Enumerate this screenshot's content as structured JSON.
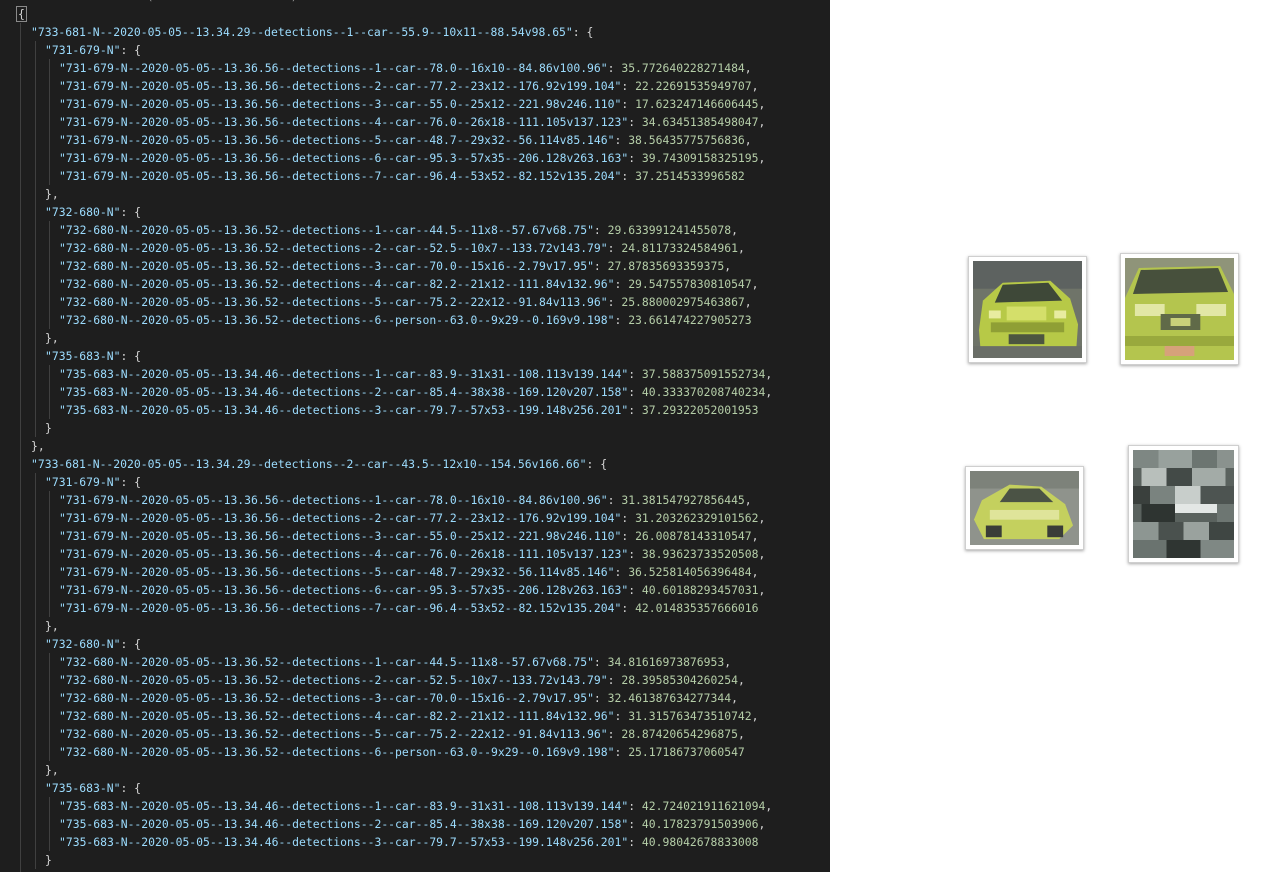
{
  "editor": {
    "top_peek": "                 (\"                   )",
    "open_brace": "{",
    "groups": [
      {
        "key": "733-681-N--2020-05-05--13.34.29--detections--1--car--55.9--10x11--88.54v98.65",
        "cameras": [
          {
            "key": "731-679-N",
            "entries": [
              {
                "k": "731-679-N--2020-05-05--13.36.56--detections--1--car--78.0--16x10--84.86v100.96",
                "v": "35.772640228271484"
              },
              {
                "k": "731-679-N--2020-05-05--13.36.56--detections--2--car--77.2--23x12--176.92v199.104",
                "v": "22.22691535949707"
              },
              {
                "k": "731-679-N--2020-05-05--13.36.56--detections--3--car--55.0--25x12--221.98v246.110",
                "v": "17.623247146606445"
              },
              {
                "k": "731-679-N--2020-05-05--13.36.56--detections--4--car--76.0--26x18--111.105v137.123",
                "v": "34.63451385498047"
              },
              {
                "k": "731-679-N--2020-05-05--13.36.56--detections--5--car--48.7--29x32--56.114v85.146",
                "v": "38.56435775756836"
              },
              {
                "k": "731-679-N--2020-05-05--13.36.56--detections--6--car--95.3--57x35--206.128v263.163",
                "v": "39.74309158325195"
              },
              {
                "k": "731-679-N--2020-05-05--13.36.56--detections--7--car--96.4--53x52--82.152v135.204",
                "v": "37.2514533996582"
              }
            ]
          },
          {
            "key": "732-680-N",
            "entries": [
              {
                "k": "732-680-N--2020-05-05--13.36.52--detections--1--car--44.5--11x8--57.67v68.75",
                "v": "29.633991241455078"
              },
              {
                "k": "732-680-N--2020-05-05--13.36.52--detections--2--car--52.5--10x7--133.72v143.79",
                "v": "24.81173324584961"
              },
              {
                "k": "732-680-N--2020-05-05--13.36.52--detections--3--car--70.0--15x16--2.79v17.95",
                "v": "27.87835693359375"
              },
              {
                "k": "732-680-N--2020-05-05--13.36.52--detections--4--car--82.2--21x12--111.84v132.96",
                "v": "29.547557830810547"
              },
              {
                "k": "732-680-N--2020-05-05--13.36.52--detections--5--car--75.2--22x12--91.84v113.96",
                "v": "25.880002975463867"
              },
              {
                "k": "732-680-N--2020-05-05--13.36.52--detections--6--person--63.0--9x29--0.169v9.198",
                "v": "23.661474227905273"
              }
            ]
          },
          {
            "key": "735-683-N",
            "entries": [
              {
                "k": "735-683-N--2020-05-05--13.34.46--detections--1--car--83.9--31x31--108.113v139.144",
                "v": "37.588375091552734"
              },
              {
                "k": "735-683-N--2020-05-05--13.34.46--detections--2--car--85.4--38x38--169.120v207.158",
                "v": "40.333370208740234"
              },
              {
                "k": "735-683-N--2020-05-05--13.34.46--detections--3--car--79.7--57x53--199.148v256.201",
                "v": "37.29322052001953"
              }
            ]
          }
        ]
      },
      {
        "key": "733-681-N--2020-05-05--13.34.29--detections--2--car--43.5--12x10--154.56v166.66",
        "cameras": [
          {
            "key": "731-679-N",
            "entries": [
              {
                "k": "731-679-N--2020-05-05--13.36.56--detections--1--car--78.0--16x10--84.86v100.96",
                "v": "31.381547927856445"
              },
              {
                "k": "731-679-N--2020-05-05--13.36.56--detections--2--car--77.2--23x12--176.92v199.104",
                "v": "31.203262329101562"
              },
              {
                "k": "731-679-N--2020-05-05--13.36.56--detections--3--car--55.0--25x12--221.98v246.110",
                "v": "26.00878143310547"
              },
              {
                "k": "731-679-N--2020-05-05--13.36.56--detections--4--car--76.0--26x18--111.105v137.123",
                "v": "38.93623733520508"
              },
              {
                "k": "731-679-N--2020-05-05--13.36.56--detections--5--car--48.7--29x32--56.114v85.146",
                "v": "36.525814056396484"
              },
              {
                "k": "731-679-N--2020-05-05--13.36.56--detections--6--car--95.3--57x35--206.128v263.163",
                "v": "40.60188293457031"
              },
              {
                "k": "731-679-N--2020-05-05--13.36.56--detections--7--car--96.4--53x52--82.152v135.204",
                "v": "42.014835357666016"
              }
            ]
          },
          {
            "key": "732-680-N",
            "entries": [
              {
                "k": "732-680-N--2020-05-05--13.36.52--detections--1--car--44.5--11x8--57.67v68.75",
                "v": "34.81616973876953"
              },
              {
                "k": "732-680-N--2020-05-05--13.36.52--detections--2--car--52.5--10x7--133.72v143.79",
                "v": "28.39585304260254"
              },
              {
                "k": "732-680-N--2020-05-05--13.36.52--detections--3--car--70.0--15x16--2.79v17.95",
                "v": "32.461387634277344"
              },
              {
                "k": "732-680-N--2020-05-05--13.36.52--detections--4--car--82.2--21x12--111.84v132.96",
                "v": "31.315763473510742"
              },
              {
                "k": "732-680-N--2020-05-05--13.36.52--detections--5--car--75.2--22x12--91.84v113.96",
                "v": "28.87420654296875"
              },
              {
                "k": "732-680-N--2020-05-05--13.36.52--detections--6--person--63.0--9x29--0.169v9.198",
                "v": "25.17186737060547"
              }
            ]
          },
          {
            "key": "735-683-N",
            "entries": [
              {
                "k": "735-683-N--2020-05-05--13.34.46--detections--1--car--83.9--31x31--108.113v139.144",
                "v": "42.724021911621094"
              },
              {
                "k": "735-683-N--2020-05-05--13.34.46--detections--2--car--85.4--38x38--169.120v207.158",
                "v": "40.17823791503906"
              },
              {
                "k": "735-683-N--2020-05-05--13.34.46--detections--3--car--79.7--57x53--199.148v256.201",
                "v": "40.98042678833008"
              }
            ]
          }
        ]
      }
    ]
  },
  "colors": {
    "editor_bg": "#1e1e1e",
    "key": "#9cdcfe",
    "number": "#b5cea8",
    "punctuation": "#d4d4d4",
    "car_yellow_green": "#b8c94a"
  },
  "gallery": {
    "thumbnails": [
      {
        "name": "car-crop-1",
        "desc": "yellow-green taxi front view"
      },
      {
        "name": "car-crop-2",
        "desc": "yellow-green taxi front close-up"
      },
      {
        "name": "car-crop-3",
        "desc": "yellow-green taxi side angle"
      },
      {
        "name": "car-crop-4",
        "desc": "pixelated dark vehicle"
      }
    ]
  }
}
